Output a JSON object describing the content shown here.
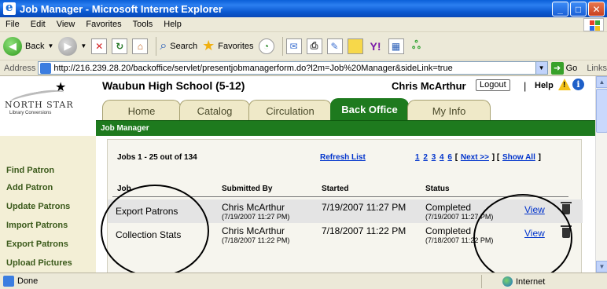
{
  "window": {
    "title": "Job Manager - Microsoft Internet Explorer"
  },
  "menu": [
    "File",
    "Edit",
    "View",
    "Favorites",
    "Tools",
    "Help"
  ],
  "toolbar": {
    "back": "Back",
    "search": "Search",
    "favorites": "Favorites"
  },
  "address": {
    "label": "Address",
    "url": "http://216.239.28.20/backoffice/servlet/presentjobmanagerform.do?l2m=Job%20Manager&sideLink=true",
    "go": "Go",
    "links": "Links"
  },
  "header": {
    "logo_text": "NORTH STAR",
    "logo_sub": "Library Conversions",
    "school": "Waubun High School (5-12)",
    "user": "Chris McArthur",
    "logout": "Logout",
    "pipe": "|",
    "help": "Help"
  },
  "tabs": [
    {
      "label": "Home"
    },
    {
      "label": "Catalog"
    },
    {
      "label": "Circulation"
    },
    {
      "label": "Back Office"
    },
    {
      "label": "My Info"
    }
  ],
  "breadcrumb": "Job Manager",
  "sidebar": [
    "Find Patron",
    "Add Patron",
    "Update Patrons",
    "Import Patrons",
    "Export Patrons",
    "Upload Pictures"
  ],
  "jobs": {
    "summary": "Jobs 1 - 25 out of 134",
    "refresh": "Refresh List",
    "pages": [
      "1",
      "2",
      "3",
      "4",
      "6"
    ],
    "next": "Next >>",
    "show_all": "Show All",
    "bracket_open": "[",
    "bracket_close": "]",
    "bracket_mid": "] [",
    "columns": [
      "Job",
      "Submitted By",
      "Started",
      "Status"
    ],
    "rows": [
      {
        "job": "Export Patrons",
        "by": "Chris McArthur",
        "by_time": "(7/19/2007 11:27 PM)",
        "started": "7/19/2007 11:27 PM",
        "status": "Completed",
        "status_time": "(7/19/2007 11:27 PM)",
        "view": "View"
      },
      {
        "job": "Collection Stats",
        "by": "Chris McArthur",
        "by_time": "(7/18/2007 11:22 PM)",
        "started": "7/18/2007 11:22 PM",
        "status": "Completed",
        "status_time": "(7/18/2007 11:22 PM)",
        "view": "View"
      }
    ]
  },
  "status": {
    "left": "Done",
    "zone": "Internet"
  }
}
